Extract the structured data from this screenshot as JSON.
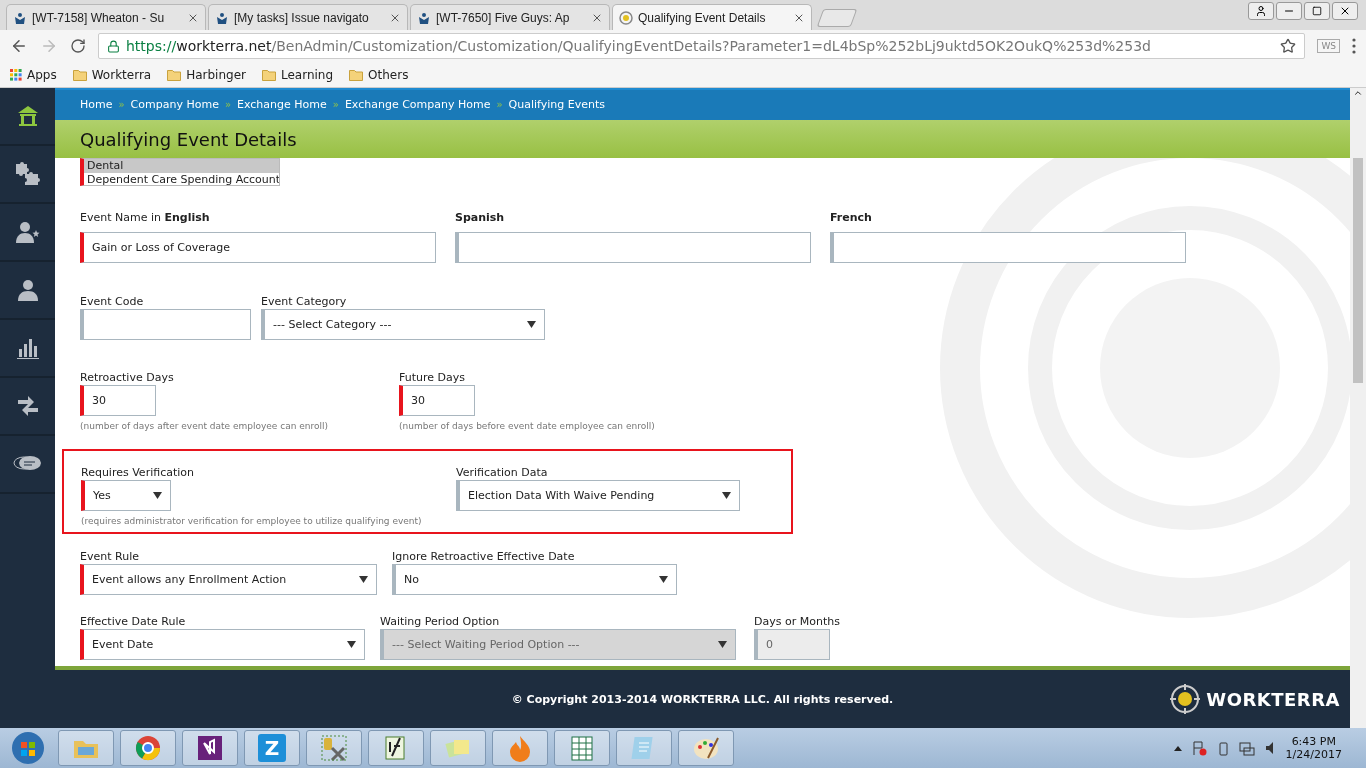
{
  "browser": {
    "tabs": [
      {
        "title": "[WT-7158] Wheaton - Su",
        "kind": "jira",
        "selected": false
      },
      {
        "title": "[My tasks] Issue navigato",
        "kind": "jira",
        "selected": false
      },
      {
        "title": "[WT-7650] Five Guys: Ap",
        "kind": "jira",
        "selected": false
      },
      {
        "title": "Qualifying Event Details",
        "kind": "site",
        "selected": true
      }
    ],
    "url_scheme": "https://",
    "url_host": "workterra.net",
    "url_path": "/BenAdmin/Customization/Customization/QualifyingEventDetails?Parameter1=dL4bSp%252bLj9uktd5OK2OukQ%253d%253d",
    "extension_label": "WS",
    "bookmarks": [
      {
        "label": "Apps",
        "kind": "apps"
      },
      {
        "label": "Workterra",
        "kind": "folder"
      },
      {
        "label": "Harbinger",
        "kind": "folder"
      },
      {
        "label": "Learning",
        "kind": "folder"
      },
      {
        "label": "Others",
        "kind": "folder"
      }
    ]
  },
  "sidebar": {
    "items": [
      {
        "kind": "home",
        "selected": true
      },
      {
        "kind": "puzzle",
        "selected": false
      },
      {
        "kind": "person-star",
        "selected": false
      },
      {
        "kind": "person",
        "selected": false
      },
      {
        "kind": "chart",
        "selected": false
      },
      {
        "kind": "arrows",
        "selected": false
      },
      {
        "kind": "chat",
        "selected": false
      }
    ]
  },
  "breadcrumbs": [
    {
      "label": "Home"
    },
    {
      "separator": "»",
      "label": "Company Home"
    },
    {
      "separator": "»",
      "label": "Exchange Home"
    },
    {
      "separator": "»",
      "label": "Exchange Company Home"
    },
    {
      "separator": "»",
      "label": "Qualifying Events"
    }
  ],
  "page_title": "Qualifying Event Details",
  "benefit_list": [
    {
      "label": "Dental",
      "selected": true
    },
    {
      "label": "Dependent Care Spending Account",
      "selected": false
    }
  ],
  "event_names": [
    {
      "label": "Event Name in **English**",
      "value": "Gain or Loss of Coverage",
      "required": true
    },
    {
      "label": "**Spanish**",
      "required": false
    },
    {
      "label": "**French**",
      "required": false
    }
  ],
  "event_code": {
    "label": "Event Code",
    "required": false
  },
  "event_category": {
    "label": "Event Category",
    "value": "--- Select Category ---",
    "required": false
  },
  "days": [
    {
      "label": "Retroactive Days",
      "value": "30",
      "hint": "(number of days after event date employee can enroll)",
      "required": true
    },
    {
      "label": "Future Days",
      "value": "30",
      "hint": "(number of days before event date employee can enroll)",
      "required": true
    }
  ],
  "verification": {
    "highlighted": true,
    "requires": {
      "label": "Requires Verification",
      "value": "Yes",
      "hint": "(requires administrator verification for employee to utilize qualifying event)",
      "required": true
    },
    "data": {
      "label": "Verification Data",
      "value": "Election Data With Waive Pending",
      "required": false
    }
  },
  "rules": [
    {
      "label": "Event Rule",
      "value": "Event allows any Enrollment Action",
      "required": true,
      "disabled": false
    },
    {
      "label": "Ignore Retroactive Effective Date",
      "value": "No",
      "required": false,
      "disabled": false
    }
  ],
  "effective": [
    {
      "label": "Effective Date Rule",
      "value": "Event Date",
      "required": true,
      "disabled": false,
      "kind": "select"
    },
    {
      "label": "Waiting Period Option",
      "value": "--- Select Waiting Period Option ---",
      "required": false,
      "disabled": true,
      "kind": "select"
    },
    {
      "label": "Days or Months",
      "value": "0",
      "required": false,
      "disabled": true,
      "kind": "input"
    }
  ],
  "footer": {
    "copyright": "© Copyright 2013-2014 WORKTERRA LLC. All rights reserved.",
    "logo_text": "WORKTERRA"
  },
  "taskbar": {
    "apps": [
      {
        "kind": "folder"
      },
      {
        "kind": "browser"
      },
      {
        "kind": "studio"
      },
      {
        "kind": "letter",
        "label": "Z"
      },
      {
        "kind": "tools"
      },
      {
        "kind": "notepad"
      },
      {
        "kind": "notes"
      },
      {
        "kind": "flame"
      },
      {
        "kind": "spreadsheet"
      },
      {
        "kind": "notebook"
      },
      {
        "kind": "paint"
      }
    ],
    "time": "6:43 PM",
    "date": "1/24/2017"
  }
}
